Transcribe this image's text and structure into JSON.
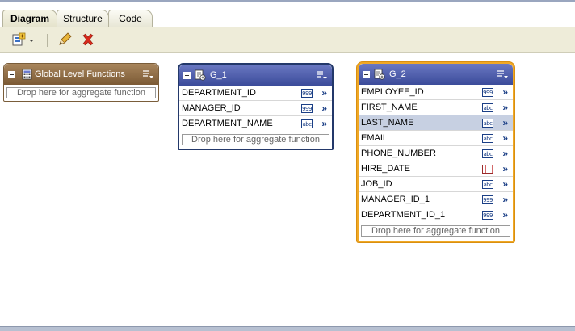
{
  "tabs": [
    {
      "label": "Diagram",
      "active": true
    },
    {
      "label": "Structure",
      "active": false
    },
    {
      "label": "Code",
      "active": false
    }
  ],
  "toolbar": {
    "icons": [
      "add-element-icon",
      "dropdown-arrow-icon",
      "edit-pencil-icon",
      "delete-x-icon"
    ]
  },
  "global_box": {
    "title": "Global Level Functions",
    "drop_text": "Drop here for aggregate function"
  },
  "g1": {
    "title": "G_1",
    "rows": [
      {
        "label": "DEPARTMENT_ID",
        "type": "999"
      },
      {
        "label": "MANAGER_ID",
        "type": "999"
      },
      {
        "label": "DEPARTMENT_NAME",
        "type": "abc"
      }
    ],
    "drop_text": "Drop here for aggregate function"
  },
  "g2": {
    "title": "G_2",
    "rows": [
      {
        "label": "EMPLOYEE_ID",
        "type": "999"
      },
      {
        "label": "FIRST_NAME",
        "type": "abc"
      },
      {
        "label": "LAST_NAME",
        "type": "abc"
      },
      {
        "label": "EMAIL",
        "type": "abc"
      },
      {
        "label": "PHONE_NUMBER",
        "type": "abc"
      },
      {
        "label": "HIRE_DATE",
        "type": "date"
      },
      {
        "label": "JOB_ID",
        "type": "abc"
      },
      {
        "label": "MANAGER_ID_1",
        "type": "999"
      },
      {
        "label": "DEPARTMENT_ID_1",
        "type": "999"
      }
    ],
    "drop_text": "Drop here for aggregate function",
    "selected_row": "LAST_NAME"
  },
  "colors": {
    "brown_header": "#7b5a35",
    "blue_header": "#3b4b9a",
    "selection_border": "#f0a825",
    "row_highlight": "#c7d0e2"
  }
}
